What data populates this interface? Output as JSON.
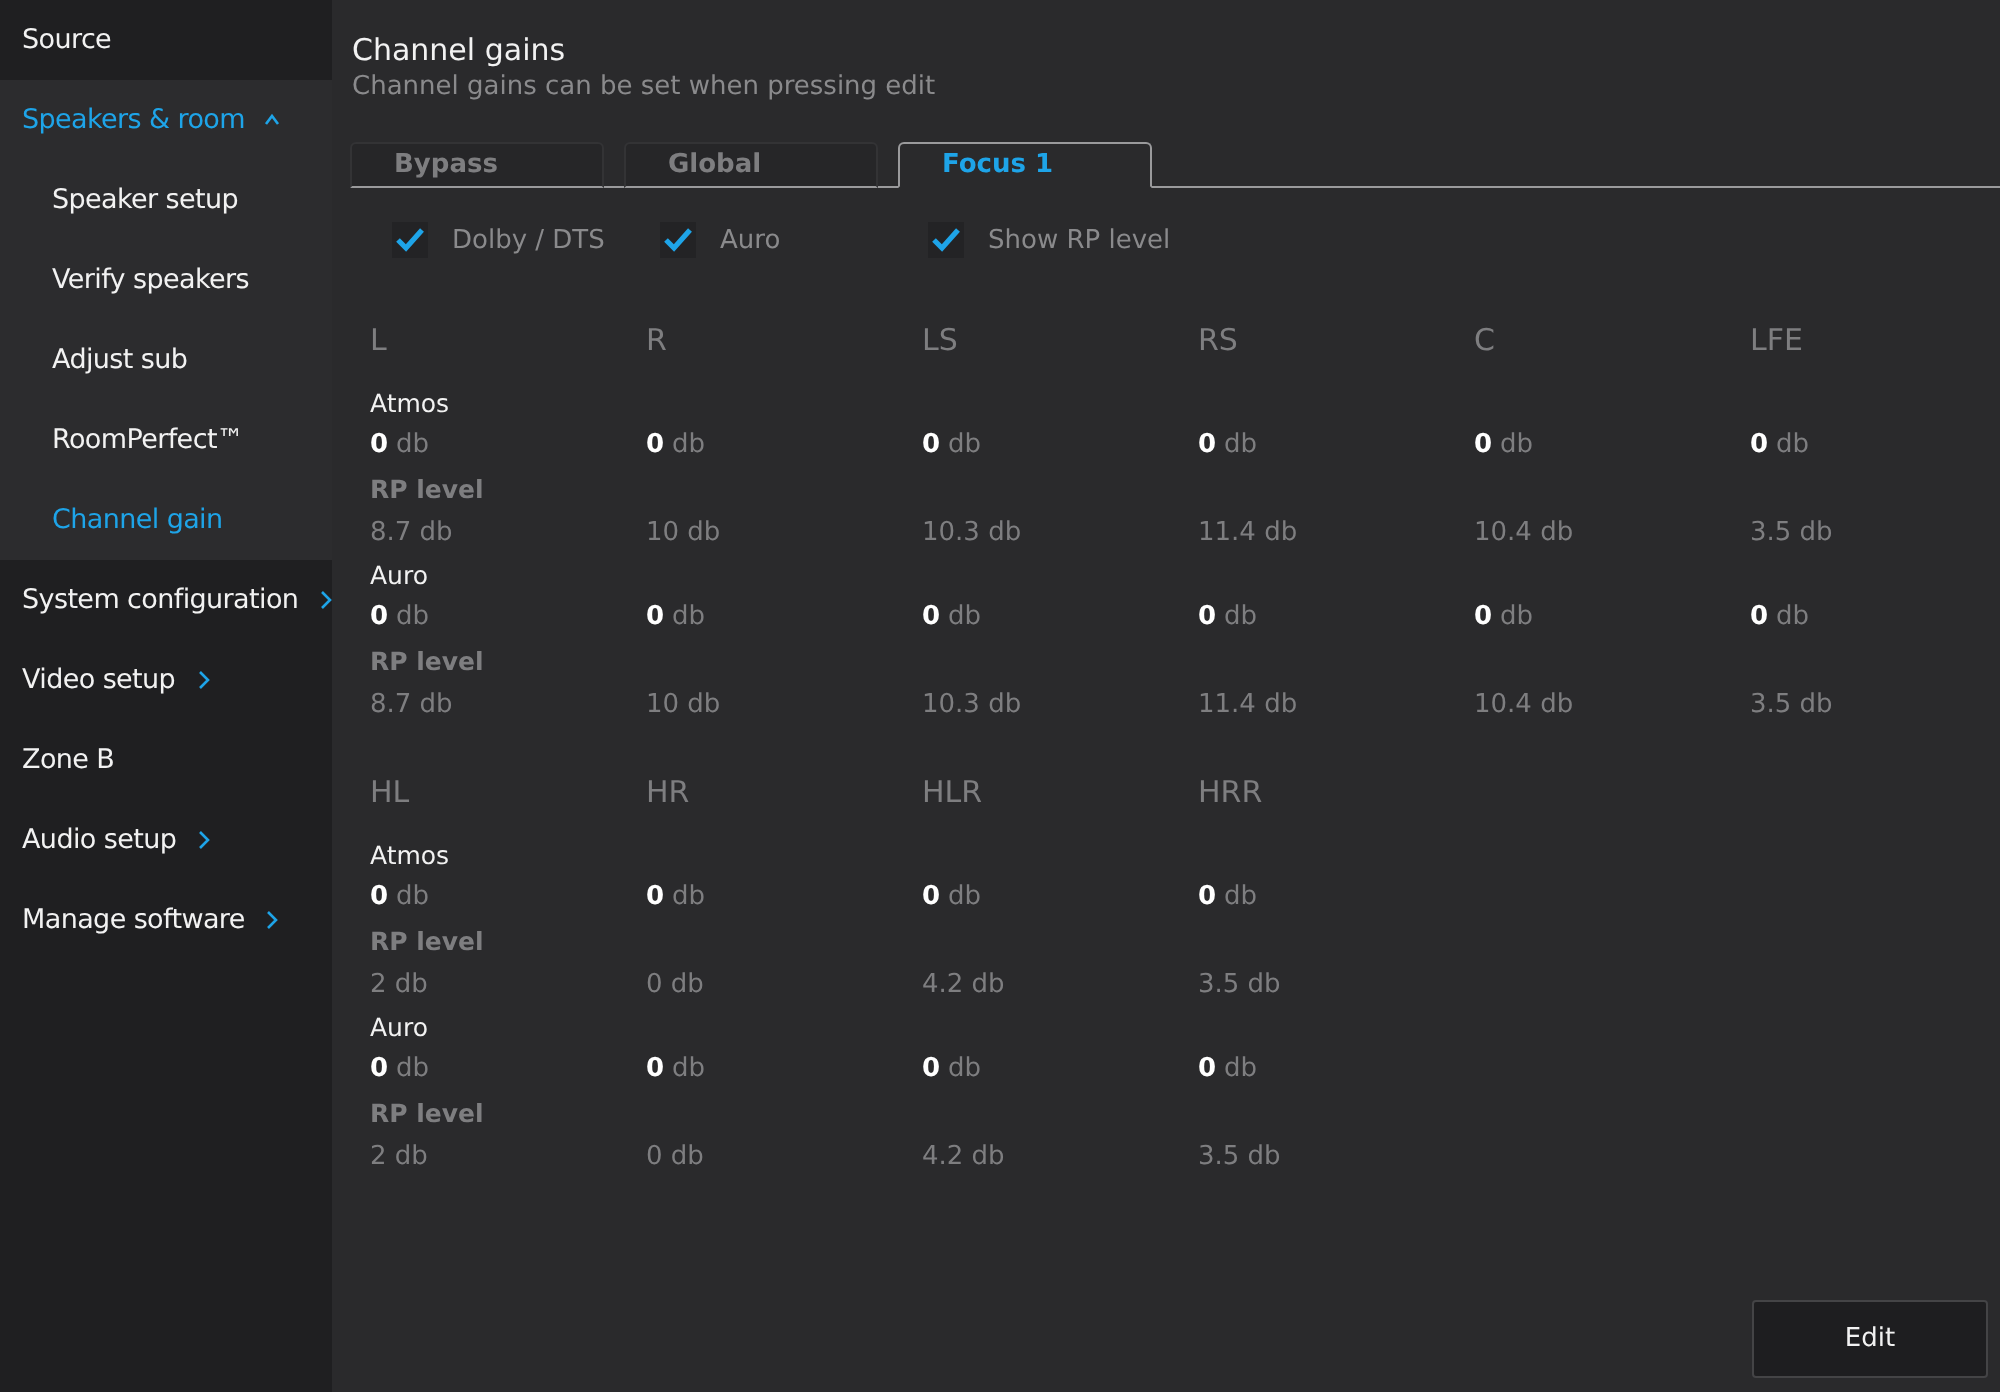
{
  "sidebar": {
    "items": [
      {
        "label": "Source",
        "kind": "link",
        "selected": false
      },
      {
        "label": "Speakers & room",
        "kind": "group",
        "expanded": true,
        "selected": true,
        "children": [
          {
            "label": "Speaker setup",
            "selected": false
          },
          {
            "label": "Verify speakers",
            "selected": false
          },
          {
            "label": "Adjust sub",
            "selected": false
          },
          {
            "label": "RoomPerfect™",
            "selected": false
          },
          {
            "label": "Channel gain",
            "selected": true
          }
        ]
      },
      {
        "label": "System configuration",
        "kind": "group",
        "expanded": false,
        "selected": false
      },
      {
        "label": "Video setup",
        "kind": "group",
        "expanded": false,
        "selected": false
      },
      {
        "label": "Zone B",
        "kind": "link",
        "selected": false
      },
      {
        "label": "Audio setup",
        "kind": "group",
        "expanded": false,
        "selected": false
      },
      {
        "label": "Manage software",
        "kind": "group",
        "expanded": false,
        "selected": false
      }
    ]
  },
  "page": {
    "title": "Channel gains",
    "subtitle": "Channel gains can be set when pressing edit"
  },
  "tabs": [
    {
      "label": "Bypass",
      "selected": false
    },
    {
      "label": "Global",
      "selected": false
    },
    {
      "label": "Focus 1",
      "selected": true
    }
  ],
  "options": [
    {
      "label": "Dolby / DTS",
      "checked": true
    },
    {
      "label": "Auro",
      "checked": true
    },
    {
      "label": "Show RP level",
      "checked": true
    }
  ],
  "groups": [
    {
      "channels": [
        "L",
        "R",
        "LS",
        "RS",
        "C",
        "LFE"
      ],
      "sections": [
        {
          "label": "Atmos",
          "values": [
            {
              "value": "0",
              "unit": "db"
            },
            {
              "value": "0",
              "unit": "db"
            },
            {
              "value": "0",
              "unit": "db"
            },
            {
              "value": "0",
              "unit": "db"
            },
            {
              "value": "0",
              "unit": "db"
            },
            {
              "value": "0",
              "unit": "db"
            }
          ],
          "rp_label": "RP level",
          "rp_values": [
            "8.7 db",
            "10 db",
            "10.3 db",
            "11.4 db",
            "10.4 db",
            "3.5 db"
          ]
        },
        {
          "label": "Auro",
          "values": [
            {
              "value": "0",
              "unit": "db"
            },
            {
              "value": "0",
              "unit": "db"
            },
            {
              "value": "0",
              "unit": "db"
            },
            {
              "value": "0",
              "unit": "db"
            },
            {
              "value": "0",
              "unit": "db"
            },
            {
              "value": "0",
              "unit": "db"
            }
          ],
          "rp_label": "RP level",
          "rp_values": [
            "8.7 db",
            "10 db",
            "10.3 db",
            "11.4 db",
            "10.4 db",
            "3.5 db"
          ]
        }
      ]
    },
    {
      "channels": [
        "HL",
        "HR",
        "HLR",
        "HRR"
      ],
      "sections": [
        {
          "label": "Atmos",
          "values": [
            {
              "value": "0",
              "unit": "db"
            },
            {
              "value": "0",
              "unit": "db"
            },
            {
              "value": "0",
              "unit": "db"
            },
            {
              "value": "0",
              "unit": "db"
            }
          ],
          "rp_label": "RP level",
          "rp_values": [
            "2 db",
            "0 db",
            "4.2 db",
            "3.5 db"
          ]
        },
        {
          "label": "Auro",
          "values": [
            {
              "value": "0",
              "unit": "db"
            },
            {
              "value": "0",
              "unit": "db"
            },
            {
              "value": "0",
              "unit": "db"
            },
            {
              "value": "0",
              "unit": "db"
            }
          ],
          "rp_label": "RP level",
          "rp_values": [
            "2 db",
            "0 db",
            "4.2 db",
            "3.5 db"
          ]
        }
      ]
    }
  ],
  "edit_button": "Edit"
}
